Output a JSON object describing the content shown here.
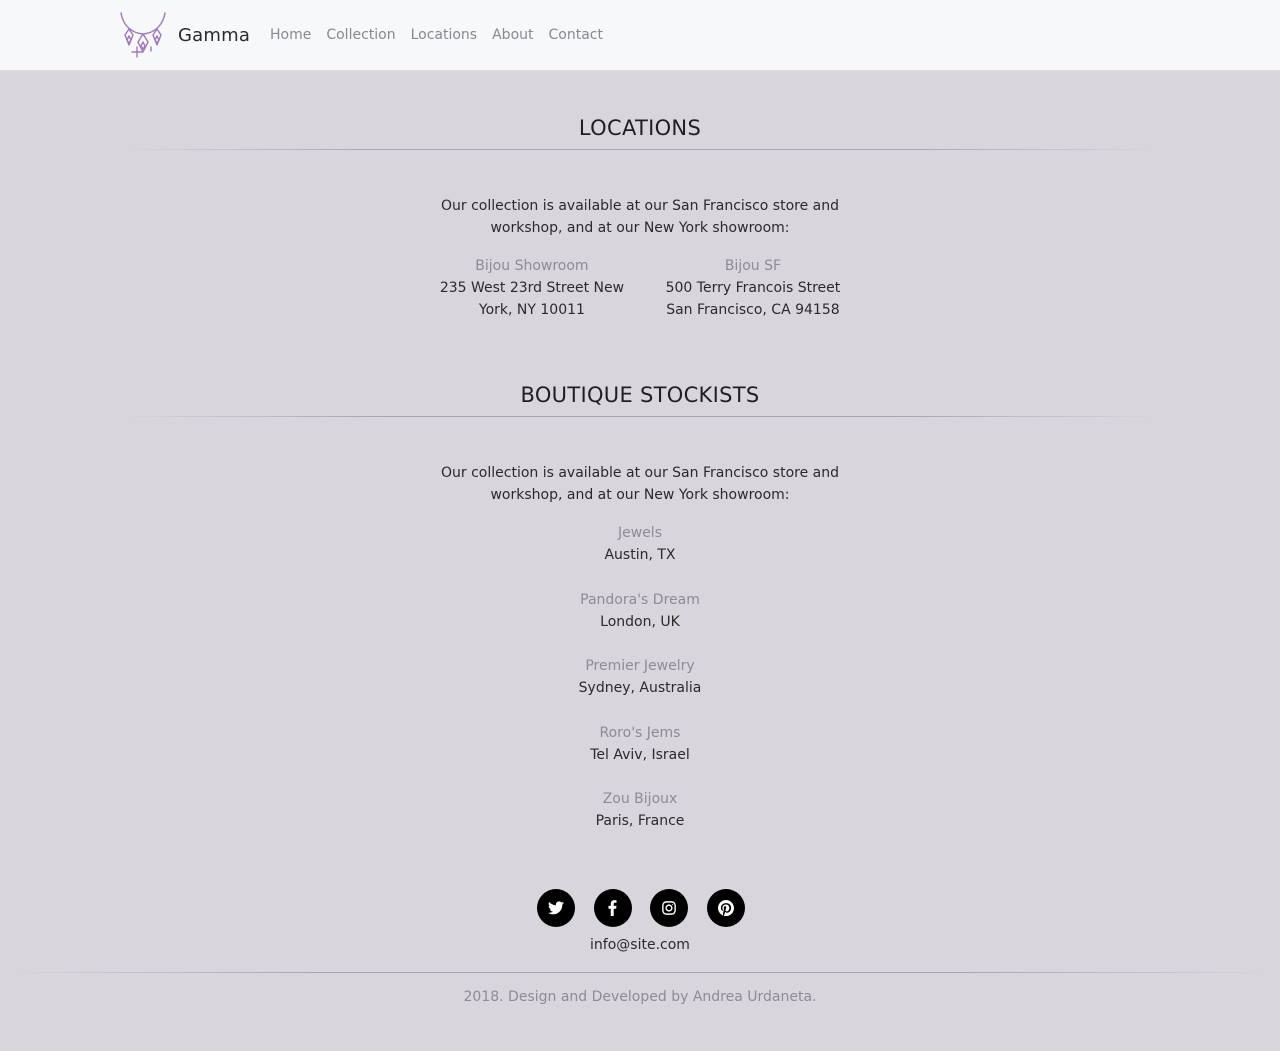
{
  "brand": {
    "name": "Gamma",
    "logo_icon": "necklace-logo-icon",
    "logo_color": "#a07ab8"
  },
  "nav": {
    "items": [
      {
        "label": "Home"
      },
      {
        "label": "Collection"
      },
      {
        "label": "Locations"
      },
      {
        "label": "About"
      },
      {
        "label": "Contact"
      }
    ]
  },
  "locations": {
    "title": "LOCATIONS",
    "intro": "Our collection is available at our San Francisco store and workshop, and at our New York showroom:",
    "stores": [
      {
        "name": "Bijou Showroom",
        "address": "235 West 23rd Street New York, NY 10011"
      },
      {
        "name": "Bijou SF",
        "address": "500 Terry Francois Street San Francisco, CA 94158"
      }
    ]
  },
  "stockists": {
    "title": "BOUTIQUE STOCKISTS",
    "intro": "Our collection is available at our San Francisco store and workshop, and at our New York showroom:",
    "items": [
      {
        "name": "Jewels",
        "city": "Austin, TX"
      },
      {
        "name": "Pandora's Dream",
        "city": "London, UK"
      },
      {
        "name": "Premier Jewelry",
        "city": "Sydney, Australia"
      },
      {
        "name": "Roro's Jems",
        "city": "Tel Aviv, Israel"
      },
      {
        "name": "Zou Bijoux",
        "city": "Paris, France"
      }
    ]
  },
  "footer": {
    "social": [
      {
        "icon": "twitter-icon"
      },
      {
        "icon": "facebook-icon"
      },
      {
        "icon": "instagram-icon"
      },
      {
        "icon": "pinterest-icon"
      }
    ],
    "email": "info@site.com",
    "copyright": "2018. Design and Developed by Andrea Urdaneta."
  },
  "colors": {
    "page_background": "#d9d5dd",
    "navbar_background": "#f7f8fa",
    "muted_text": "#8f8a95",
    "social_button": "#000000"
  }
}
